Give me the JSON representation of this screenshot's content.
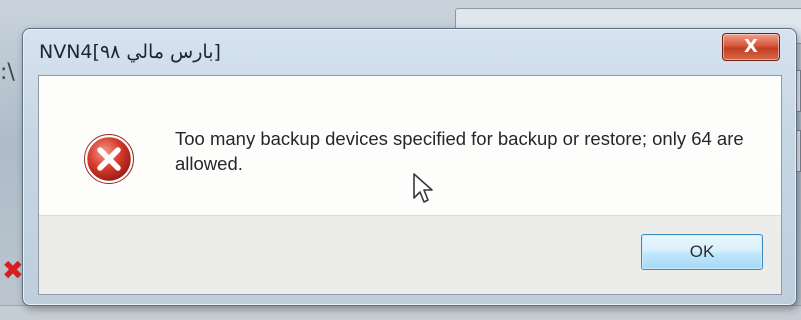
{
  "background": {
    "left_label": ":\\"
  },
  "dialog": {
    "title": "NVN4[بارس مالي ٩٨]",
    "close_glyph": "X",
    "message": "Too many backup devices specified for backup or restore; only 64 are allowed.",
    "icon": "error-icon",
    "ok_label": "OK",
    "colors": {
      "close_button": "#d9583c",
      "error_icon": "#d42a2a",
      "ok_border": "#3b8ac0"
    }
  }
}
